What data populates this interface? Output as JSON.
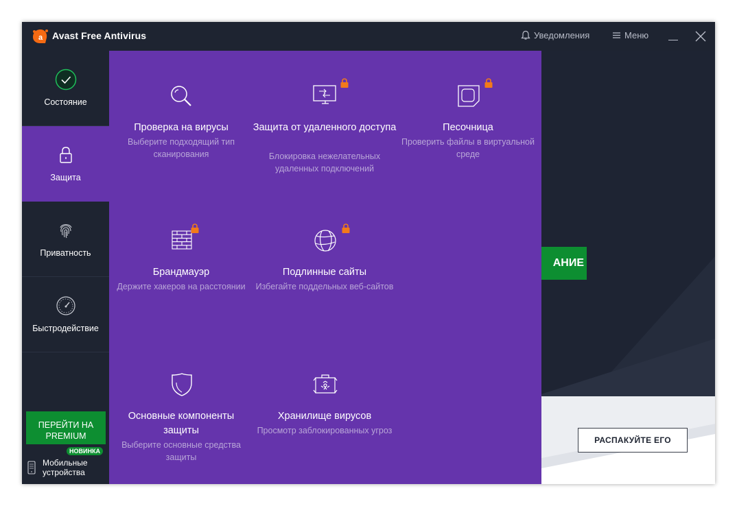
{
  "app": {
    "title": "Avast Free Antivirus",
    "brand_color": "#f46a13",
    "notifications_label": "Уведомления",
    "menu_label": "Меню"
  },
  "sidebar": {
    "items": [
      {
        "label": "Состояние",
        "icon": "check-circle-icon"
      },
      {
        "label": "Защита",
        "icon": "lock-icon",
        "active": true
      },
      {
        "label": "Приватность",
        "icon": "fingerprint-icon"
      },
      {
        "label": "Быстродействие",
        "icon": "speedometer-icon"
      }
    ],
    "premium_label": "ПЕРЕЙТИ НА PREMIUM",
    "new_badge": "НОВИНКА",
    "mobile_label": "Мобильные устройства"
  },
  "panel": {
    "tiles": [
      {
        "title": "Проверка на вирусы",
        "desc": "Выберите подходящий тип сканирования",
        "icon": "magnifier-icon",
        "locked": false
      },
      {
        "title": "Защита от удаленного доступа",
        "desc": "Блокировка нежелательных удаленных подключений",
        "icon": "remote-monitor-icon",
        "locked": true
      },
      {
        "title": "Песочница",
        "desc": "Проверить файлы в виртуальной среде",
        "icon": "sandbox-icon",
        "locked": true
      },
      {
        "title": "Брандмауэр",
        "desc": "Держите хакеров на расстоянии",
        "icon": "firewall-icon",
        "locked": true
      },
      {
        "title": "Подлинные сайты",
        "desc": "Избегайте поддельных веб-сайтов",
        "icon": "globe-icon",
        "locked": true
      },
      {
        "title": "Основные компоненты защиты",
        "desc": "Выберите основные средства защиты",
        "icon": "shield-icon",
        "locked": false
      },
      {
        "title": "Хранилище вирусов",
        "desc": "Просмотр заблокированных угроз",
        "icon": "virus-chest-icon",
        "locked": false
      }
    ]
  },
  "dashboard": {
    "scan_label_fragment": "АНИЕ",
    "unpack_label": "РАСПАКУЙТЕ ЕГО"
  },
  "colors": {
    "panel_purple": "#6534ac",
    "dark_bg": "#1e2431",
    "green": "#0d8e31",
    "lock_orange": "#f27a1a"
  }
}
